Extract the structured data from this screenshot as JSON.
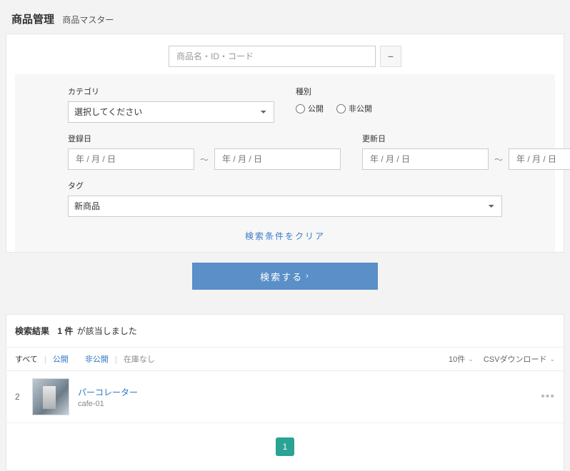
{
  "header": {
    "title": "商品管理",
    "subtitle": "商品マスター"
  },
  "search": {
    "placeholder": "商品名・ID・コード",
    "collapse_symbol": "−",
    "category_label": "カテゴリ",
    "category_placeholder": "選択してください",
    "type_label": "種別",
    "type_public": "公開",
    "type_private": "非公開",
    "reg_date_label": "登録日",
    "upd_date_label": "更新日",
    "date_placeholder": "年 / 月 / 日",
    "date_sep": "〜",
    "tag_label": "タグ",
    "tag_value": "新商品",
    "clear_label": "検索条件をクリア",
    "submit_label": "検索する"
  },
  "results": {
    "heading": "検索結果",
    "count": "1 件",
    "suffix": "が該当しました",
    "filter_all": "すべて",
    "filter_public": "公開",
    "filter_private": "非公開",
    "filter_nostock": "在庫なし",
    "per_page": "10件",
    "csv_label": "CSVダウンロード",
    "item": {
      "index": "2",
      "name": "パーコレーター",
      "code": "cafe-01"
    },
    "page": "1"
  }
}
